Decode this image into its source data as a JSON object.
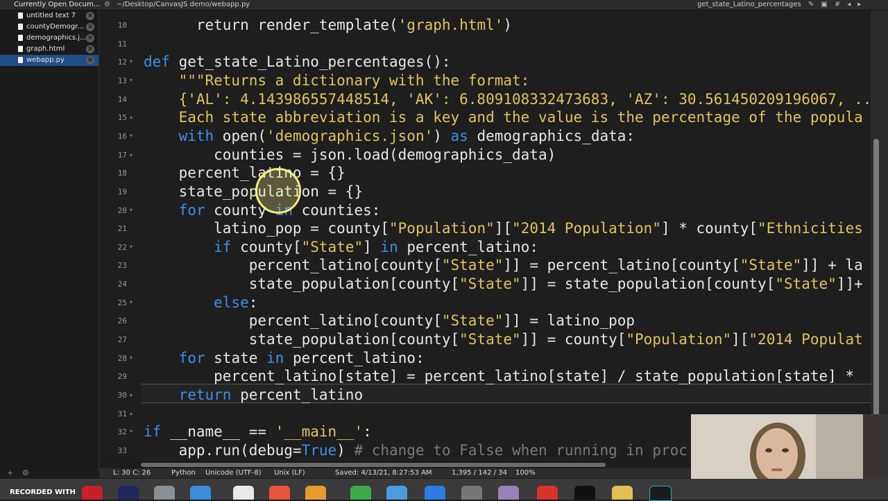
{
  "topbar": {
    "sidebar_title": "Currently Open Docum...",
    "path": "~/Desktop/CanvasJS demo/webapp.py",
    "function_menu": "get_state_Latino_percentages"
  },
  "sidebar": {
    "documents": [
      {
        "name": "untitled text 7",
        "active": false
      },
      {
        "name": "countyDemogr...",
        "active": false
      },
      {
        "name": "demographics.j...",
        "active": false
      },
      {
        "name": "graph.html",
        "active": false
      },
      {
        "name": "webapp.py",
        "active": true
      }
    ]
  },
  "editor": {
    "lines": [
      {
        "num": "10",
        "tokens": [
          [
            "      ",
            ""
          ],
          [
            "return",
            ""
          ],
          [
            " render_template(",
            ""
          ],
          [
            "'graph.html'",
            "str"
          ],
          [
            ")",
            ""
          ]
        ]
      },
      {
        "num": "11",
        "tokens": [
          [
            "",
            ""
          ]
        ]
      },
      {
        "num": "12",
        "tokens": [
          [
            "def",
            "kw"
          ],
          [
            " get_state_Latino_percentages():",
            ""
          ]
        ]
      },
      {
        "num": "13",
        "tokens": [
          [
            "    \"\"\"Returns a dictionary with the format:",
            "str"
          ]
        ]
      },
      {
        "num": "14",
        "tokens": [
          [
            "    {'AL': 4.143986557448514, 'AK': 6.809108332473683, 'AZ': 30.561450209196067, ...",
            "str"
          ]
        ]
      },
      {
        "num": "15",
        "tokens": [
          [
            "    Each state abbreviation is a key and the value is the percentage of the popula",
            "str"
          ]
        ]
      },
      {
        "num": "16",
        "tokens": [
          [
            "    ",
            ""
          ],
          [
            "with",
            "kw"
          ],
          [
            " open(",
            ""
          ],
          [
            "'demographics.json'",
            "str"
          ],
          [
            ") ",
            ""
          ],
          [
            "as",
            "kw"
          ],
          [
            " demographics_data:",
            ""
          ]
        ]
      },
      {
        "num": "17",
        "tokens": [
          [
            "        counties = json.load(demographics_data)",
            ""
          ]
        ]
      },
      {
        "num": "18",
        "tokens": [
          [
            "    percent_latino = {}",
            ""
          ]
        ]
      },
      {
        "num": "19",
        "tokens": [
          [
            "    state_population = {}",
            ""
          ]
        ]
      },
      {
        "num": "20",
        "tokens": [
          [
            "    ",
            ""
          ],
          [
            "for",
            "kw"
          ],
          [
            " county ",
            ""
          ],
          [
            "in",
            "kw"
          ],
          [
            " counties:",
            ""
          ]
        ]
      },
      {
        "num": "21",
        "tokens": [
          [
            "        latino_pop = county[",
            ""
          ],
          [
            "\"Population\"",
            "str"
          ],
          [
            "][",
            ""
          ],
          [
            "\"2014 Population\"",
            "str"
          ],
          [
            "] * county[",
            ""
          ],
          [
            "\"Ethnicities",
            "str"
          ]
        ]
      },
      {
        "num": "22",
        "tokens": [
          [
            "        ",
            ""
          ],
          [
            "if",
            "kw"
          ],
          [
            " county[",
            ""
          ],
          [
            "\"State\"",
            "str"
          ],
          [
            "] ",
            ""
          ],
          [
            "in",
            "kw"
          ],
          [
            " percent_latino:",
            ""
          ]
        ]
      },
      {
        "num": "23",
        "tokens": [
          [
            "            percent_latino[county[",
            ""
          ],
          [
            "\"State\"",
            "str"
          ],
          [
            "]] = percent_latino[county[",
            ""
          ],
          [
            "\"State\"",
            "str"
          ],
          [
            "]] + la",
            ""
          ]
        ]
      },
      {
        "num": "24",
        "tokens": [
          [
            "            state_population[county[",
            ""
          ],
          [
            "\"State\"",
            "str"
          ],
          [
            "]] = state_population[county[",
            ""
          ],
          [
            "\"State\"",
            "str"
          ],
          [
            "]]+",
            ""
          ]
        ]
      },
      {
        "num": "25",
        "tokens": [
          [
            "        ",
            ""
          ],
          [
            "else",
            "kw"
          ],
          [
            ":",
            ""
          ]
        ]
      },
      {
        "num": "26",
        "tokens": [
          [
            "            percent_latino[county[",
            ""
          ],
          [
            "\"State\"",
            "str"
          ],
          [
            "]] = latino_pop",
            ""
          ]
        ]
      },
      {
        "num": "27",
        "tokens": [
          [
            "            state_population[county[",
            ""
          ],
          [
            "\"State\"",
            "str"
          ],
          [
            "]] = county[",
            ""
          ],
          [
            "\"Population\"",
            "str"
          ],
          [
            "][",
            ""
          ],
          [
            "\"2014 Populat",
            "str"
          ]
        ]
      },
      {
        "num": "28",
        "tokens": [
          [
            "    ",
            ""
          ],
          [
            "for",
            "kw"
          ],
          [
            " state ",
            ""
          ],
          [
            "in",
            "kw"
          ],
          [
            " percent_latino:",
            ""
          ]
        ]
      },
      {
        "num": "29",
        "tokens": [
          [
            "        percent_latino[state] = percent_latino[state] / state_population[state] *",
            ""
          ]
        ]
      },
      {
        "num": "30",
        "tokens": [
          [
            "    ",
            ""
          ],
          [
            "return",
            "kw"
          ],
          [
            " percent_latino",
            ""
          ]
        ]
      },
      {
        "num": "31",
        "tokens": [
          [
            "",
            ""
          ]
        ]
      },
      {
        "num": "32",
        "tokens": [
          [
            "if",
            "kw"
          ],
          [
            " __name__ == ",
            ""
          ],
          [
            "'__main__'",
            "str"
          ],
          [
            ":",
            ""
          ]
        ]
      },
      {
        "num": "33",
        "tokens": [
          [
            "    app.run(debug=",
            ""
          ],
          [
            "True",
            "kw"
          ],
          [
            ") ",
            ""
          ],
          [
            "# change to False when running in proc",
            "com"
          ]
        ]
      }
    ]
  },
  "statusbar": {
    "position": "L: 30 C: 26",
    "language": "Python",
    "encoding": "Unicode (UTF-8)",
    "line_endings": "Unix (LF)",
    "saved": "Saved: 4/13/21, 8:27:53 AM",
    "stats": "1,395 / 142 / 34",
    "zoom": "100%"
  },
  "dock": {
    "recorded_label": "RECORDED WITH"
  },
  "colors": {
    "keyword": "#3d8ee8",
    "string": "#e0c45c",
    "comment": "#7a7a7a",
    "active_doc": "#1f4e87"
  }
}
